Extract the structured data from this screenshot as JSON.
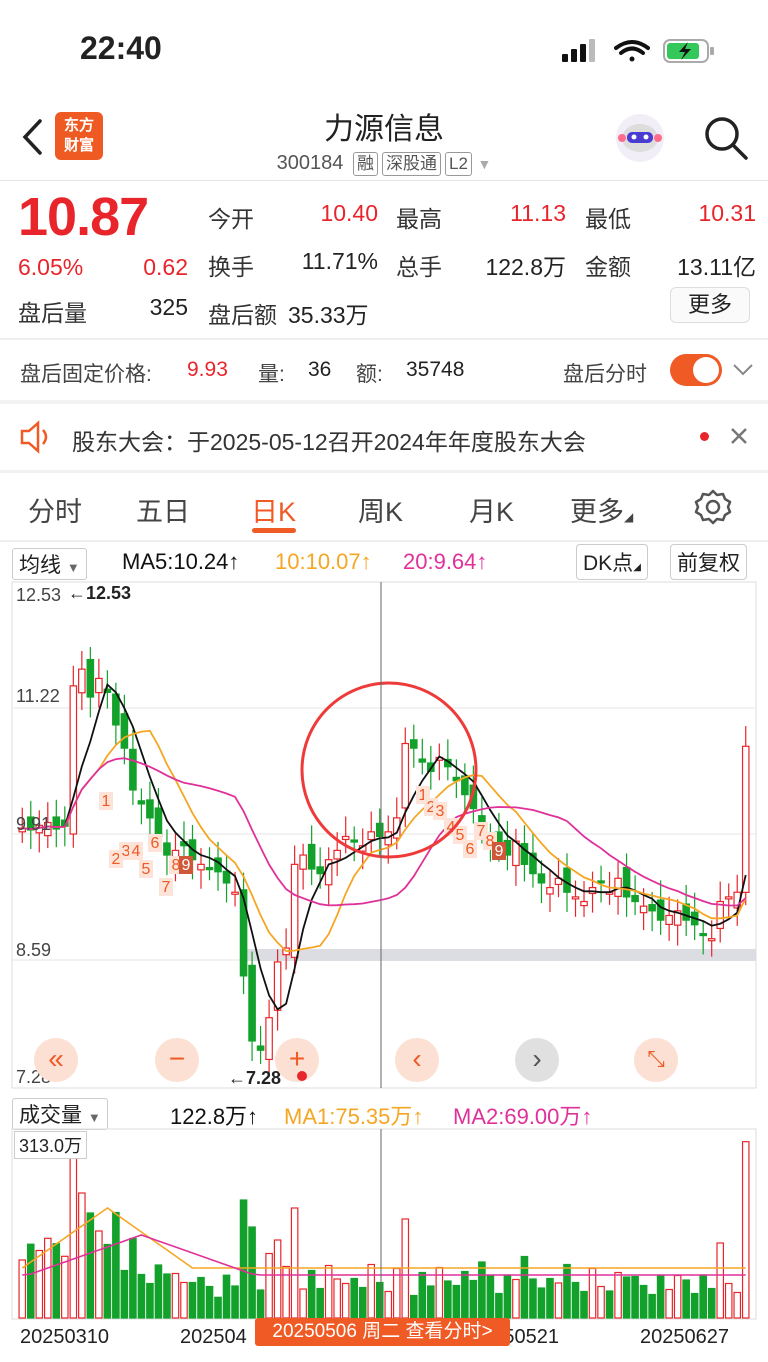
{
  "status_bar": {
    "time": "22:40"
  },
  "header": {
    "logo_line1": "东方",
    "logo_line2": "财富",
    "stock_name": "力源信息",
    "stock_code": "300184",
    "tags": [
      "融",
      "深股通",
      "L2"
    ]
  },
  "quote": {
    "price": "10.87",
    "change_pct": "6.05%",
    "change_amt": "0.62",
    "after_vol_label": "盘后量",
    "after_vol": "325",
    "open_label": "今开",
    "open": "10.40",
    "high_label": "最高",
    "high": "11.13",
    "low_label": "最低",
    "low": "10.31",
    "turnover_label": "换手",
    "turnover": "11.71%",
    "total_vol_label": "总手",
    "total_vol": "122.8万",
    "amount_label": "金额",
    "amount": "13.11亿",
    "after_amt_label": "盘后额",
    "after_amt": "35.33万",
    "more": "更多"
  },
  "after_hours": {
    "price_label": "盘后固定价格:",
    "price": "9.93",
    "vol_label": "量:",
    "vol": "36",
    "amt_label": "额:",
    "amt": "35748",
    "timeshare_label": "盘后分时"
  },
  "notice": {
    "text": "股东大会：于2025-05-12召开2024年年度股东大会"
  },
  "tabs": [
    "分时",
    "五日",
    "日K",
    "周K",
    "月K",
    "更多"
  ],
  "kline_bar": {
    "indicator": "均线",
    "ma5": "MA5:10.24↑",
    "ma10": "10:10.07↑",
    "ma20": "20:9.64↑",
    "dk": "DK点",
    "adjust": "前复权"
  },
  "kline_axis": {
    "y_labels": [
      "12.53",
      "11.22",
      "9.91",
      "8.59",
      "7.28"
    ],
    "max_mark": "←12.53",
    "min_mark": "←7.28"
  },
  "volume_bar": {
    "indicator": "成交量",
    "vol": "122.8万↑",
    "ma1": "MA1:75.35万↑",
    "ma2": "MA2:69.00万↑",
    "max_label": "313.0万"
  },
  "x_axis": {
    "labels": [
      "20250310",
      "202504",
      "20250521",
      "20250627"
    ],
    "crosshair_label": "20250506 周二 查看分时>"
  },
  "colors": {
    "up": "#e8252b",
    "down": "#12a12a",
    "accent": "#f05a24",
    "ma5": "#111111",
    "ma10": "#f5a623",
    "ma20": "#e0319a"
  }
}
